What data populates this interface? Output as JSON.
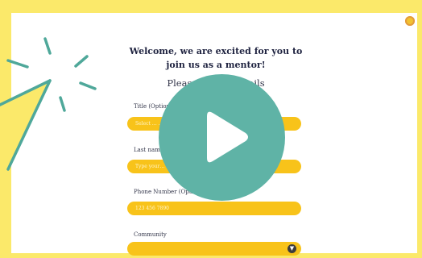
{
  "form": {
    "welcome": "Welcome, we are excited for you to join us as a mentor!",
    "subtitle": "Please en… …details",
    "fields": [
      {
        "label": "Title (Option…",
        "placeholder": "Select … …eave this"
      },
      {
        "label": "Last nam…",
        "placeholder": "Type your…"
      },
      {
        "label": "Phone Number (Optio…",
        "placeholder": "123 456 7890"
      },
      {
        "label": "Community",
        "placeholder": ""
      }
    ]
  },
  "video": {
    "play_icon": "play-icon"
  },
  "colors": {
    "frame": "#fbe96a",
    "field": "#f8c31a",
    "play_button": "#5fb3a6",
    "accent_lines": "#4fa89a"
  },
  "icons": [
    "avatar",
    "sparkle-lines",
    "paper-plane-shape",
    "chevron-down-icon"
  ]
}
